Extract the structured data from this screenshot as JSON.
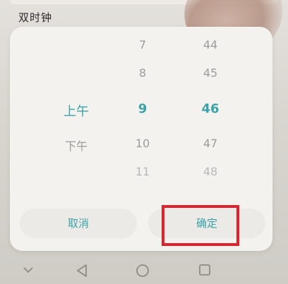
{
  "background": {
    "section_title": "双时钟"
  },
  "picker": {
    "ampm": [
      {
        "label": "",
        "state": "hidden"
      },
      {
        "label": "",
        "state": "hidden"
      },
      {
        "label": "上午",
        "state": "selected"
      },
      {
        "label": "下午",
        "state": "normal"
      },
      {
        "label": "",
        "state": "hidden"
      }
    ],
    "hours": [
      {
        "label": "7",
        "state": "normal"
      },
      {
        "label": "8",
        "state": "normal"
      },
      {
        "label": "9",
        "state": "selected"
      },
      {
        "label": "10",
        "state": "normal"
      },
      {
        "label": "11",
        "state": "faint"
      }
    ],
    "minutes": [
      {
        "label": "44",
        "state": "normal"
      },
      {
        "label": "45",
        "state": "normal"
      },
      {
        "label": "46",
        "state": "selected"
      },
      {
        "label": "47",
        "state": "normal"
      },
      {
        "label": "48",
        "state": "faint"
      }
    ]
  },
  "buttons": {
    "cancel_label": "取消",
    "ok_label": "确定"
  },
  "navbar": {
    "down_icon": "chevron-down-icon",
    "back_icon": "back-triangle-icon",
    "home_icon": "home-circle-icon",
    "recent_icon": "recent-square-icon"
  },
  "colors": {
    "accent": "#3aa3a9",
    "highlight": "#e4202a"
  }
}
